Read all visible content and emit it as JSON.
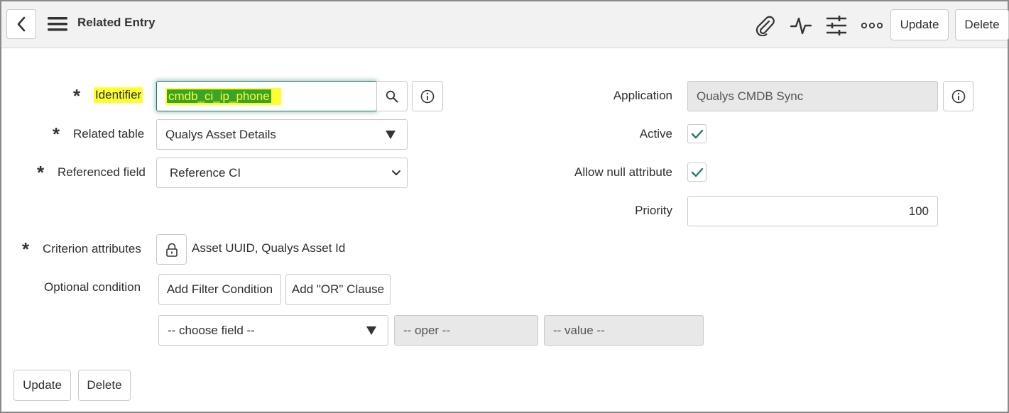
{
  "header": {
    "title": "Related Entry",
    "update_label": "Update",
    "delete_label": "Delete"
  },
  "form": {
    "identifier": {
      "label": "Identifier",
      "value": "cmdb_ci_ip_phone"
    },
    "related_table": {
      "label": "Related table",
      "value": "Qualys Asset Details"
    },
    "referenced_field": {
      "label": "Referenced field",
      "value": "Reference CI"
    },
    "criterion_attributes": {
      "label": "Criterion attributes",
      "value": "Asset UUID, Qualys Asset Id"
    },
    "optional_condition": {
      "label": "Optional condition",
      "add_filter_label": "Add Filter Condition",
      "add_or_label": "Add \"OR\" Clause",
      "choose_field_placeholder": "-- choose field --",
      "oper_placeholder": "-- oper --",
      "value_placeholder": "-- value --"
    },
    "application": {
      "label": "Application",
      "value": "Qualys CMDB Sync"
    },
    "active": {
      "label": "Active",
      "checked": true
    },
    "allow_null": {
      "label": "Allow null attribute",
      "checked": true
    },
    "priority": {
      "label": "Priority",
      "value": "100"
    }
  },
  "footer": {
    "update_label": "Update",
    "delete_label": "Delete"
  },
  "colors": {
    "highlight": "#ffff2e",
    "highlight_text_bg": "#3aa32a",
    "check": "#1f7a6a",
    "focus": "#1f7a6a"
  }
}
